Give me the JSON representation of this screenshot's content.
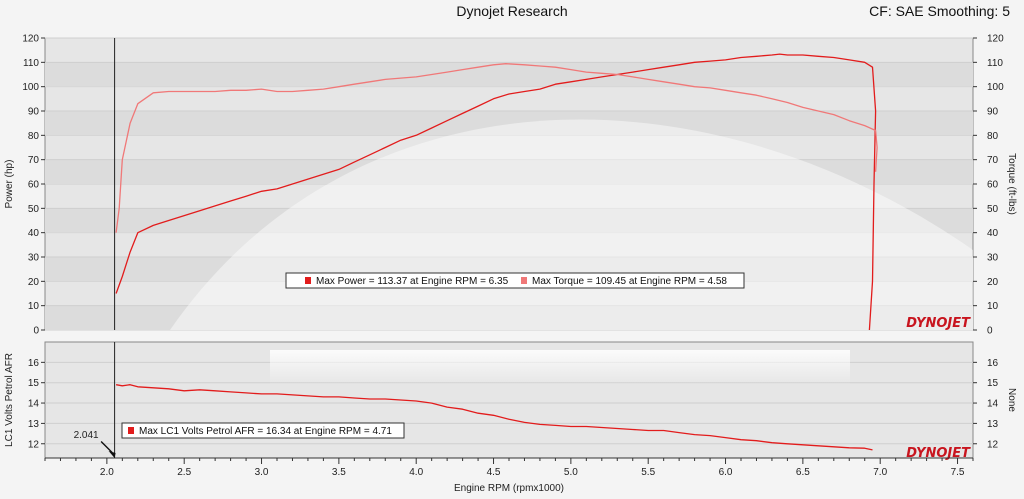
{
  "header": {
    "title": "Dynojet Research",
    "settings": "CF: SAE Smoothing: 5"
  },
  "logo": {
    "text": "DYNOJET"
  },
  "colors": {
    "power": "#e21c1c",
    "torque": "#f07878",
    "afr": "#e21c1c",
    "bg": "#f4f4f4",
    "plot": "#e6e6e6"
  },
  "cursor": {
    "rpm": 2.05,
    "label": "2.041"
  },
  "chart_data": [
    {
      "type": "line",
      "id": "power-torque",
      "xlabel": "",
      "ylabel": "Power (hp)",
      "y2label": "Torque (ft-lbs)",
      "xlim": [
        1.6,
        7.6
      ],
      "ylim": [
        0,
        120
      ],
      "y2lim": [
        0,
        120
      ],
      "yticks": [
        0,
        10,
        20,
        30,
        40,
        50,
        60,
        70,
        80,
        90,
        100,
        110,
        120
      ],
      "grid": true,
      "series": [
        {
          "name": "Power",
          "color": "#e21c1c",
          "x": [
            2.06,
            2.1,
            2.15,
            2.2,
            2.3,
            2.4,
            2.5,
            2.6,
            2.7,
            2.8,
            2.9,
            3.0,
            3.1,
            3.2,
            3.3,
            3.4,
            3.5,
            3.6,
            3.7,
            3.8,
            3.9,
            4.0,
            4.1,
            4.2,
            4.3,
            4.4,
            4.5,
            4.6,
            4.7,
            4.8,
            4.9,
            5.0,
            5.1,
            5.2,
            5.3,
            5.4,
            5.5,
            5.6,
            5.7,
            5.8,
            5.9,
            6.0,
            6.1,
            6.2,
            6.3,
            6.35,
            6.4,
            6.5,
            6.6,
            6.7,
            6.8,
            6.9,
            6.95,
            6.97,
            6.96,
            6.95,
            6.93
          ],
          "y": [
            15,
            22,
            32,
            40,
            43,
            45,
            47,
            49,
            51,
            53,
            55,
            57,
            58,
            60,
            62,
            64,
            66,
            69,
            72,
            75,
            78,
            80,
            83,
            86,
            89,
            92,
            95,
            97,
            98,
            99,
            101,
            102,
            103,
            104,
            105,
            106,
            107,
            108,
            109,
            110,
            110.5,
            111,
            112,
            112.5,
            113,
            113.37,
            113,
            113,
            112.5,
            112,
            111,
            110,
            108,
            90,
            60,
            20,
            0
          ]
        },
        {
          "name": "Torque",
          "color": "#f07878",
          "x": [
            2.06,
            2.08,
            2.1,
            2.15,
            2.2,
            2.3,
            2.4,
            2.5,
            2.6,
            2.7,
            2.8,
            2.9,
            3.0,
            3.1,
            3.2,
            3.3,
            3.4,
            3.5,
            3.6,
            3.7,
            3.8,
            3.9,
            4.0,
            4.1,
            4.2,
            4.3,
            4.4,
            4.5,
            4.58,
            4.7,
            4.8,
            4.9,
            5.0,
            5.1,
            5.2,
            5.3,
            5.4,
            5.5,
            5.6,
            5.7,
            5.8,
            5.9,
            6.0,
            6.1,
            6.2,
            6.3,
            6.4,
            6.5,
            6.6,
            6.7,
            6.8,
            6.9,
            6.97,
            6.98,
            6.97
          ],
          "y": [
            40,
            50,
            70,
            85,
            93,
            97.5,
            98,
            98,
            98,
            98,
            98.5,
            98.5,
            99,
            98,
            98,
            98.5,
            99,
            100,
            101,
            102,
            103,
            103.5,
            104,
            105,
            106,
            107,
            108,
            109,
            109.45,
            109,
            108.5,
            108,
            107,
            106,
            105.5,
            105,
            104,
            103,
            102,
            101,
            100,
            99.5,
            98.5,
            97.5,
            96.5,
            95,
            93.5,
            91.5,
            90,
            88.5,
            86,
            84,
            82,
            75,
            65
          ]
        }
      ],
      "legend": [
        {
          "label": "Max Power = 113.37 at Engine RPM = 6.35",
          "color": "#e21c1c"
        },
        {
          "label": "Max Torque = 109.45 at Engine RPM = 4.58",
          "color": "#f07878"
        }
      ]
    },
    {
      "type": "line",
      "id": "afr",
      "xlabel": "Engine RPM (rpmx1000)",
      "ylabel": "LC1 Volts Petrol AFR",
      "y2label": "None",
      "xlim": [
        1.6,
        7.6
      ],
      "ylim": [
        11.3,
        17.0
      ],
      "yticks": [
        12,
        13,
        14,
        15,
        16
      ],
      "xticks": [
        2.0,
        2.5,
        3.0,
        3.5,
        4.0,
        4.5,
        5.0,
        5.5,
        6.0,
        6.5,
        7.0,
        7.5
      ],
      "xticklabels": [
        "2.0",
        "2.5",
        "3.0",
        "3.5",
        "4.0",
        "4.5",
        "5.0",
        "5.5",
        "6.0",
        "6.5",
        "7.0",
        "7.5"
      ],
      "grid": true,
      "series": [
        {
          "name": "LC1 Volts Petrol AFR",
          "color": "#e21c1c",
          "x": [
            2.06,
            2.1,
            2.15,
            2.2,
            2.3,
            2.4,
            2.5,
            2.6,
            2.7,
            2.8,
            2.9,
            3.0,
            3.1,
            3.2,
            3.3,
            3.4,
            3.5,
            3.6,
            3.7,
            3.8,
            3.9,
            4.0,
            4.1,
            4.2,
            4.3,
            4.4,
            4.5,
            4.6,
            4.7,
            4.8,
            4.9,
            5.0,
            5.1,
            5.2,
            5.3,
            5.4,
            5.5,
            5.6,
            5.7,
            5.8,
            5.9,
            6.0,
            6.1,
            6.2,
            6.3,
            6.4,
            6.5,
            6.6,
            6.7,
            6.8,
            6.9,
            6.95
          ],
          "y": [
            14.9,
            14.85,
            14.9,
            14.8,
            14.75,
            14.7,
            14.6,
            14.65,
            14.6,
            14.55,
            14.5,
            14.45,
            14.45,
            14.4,
            14.35,
            14.3,
            14.3,
            14.25,
            14.2,
            14.2,
            14.15,
            14.1,
            14.0,
            13.8,
            13.7,
            13.5,
            13.4,
            13.2,
            13.05,
            12.95,
            12.9,
            12.85,
            12.85,
            12.8,
            12.75,
            12.7,
            12.65,
            12.65,
            12.55,
            12.45,
            12.4,
            12.3,
            12.2,
            12.15,
            12.05,
            12.0,
            11.95,
            11.9,
            11.85,
            11.8,
            11.78,
            11.7
          ]
        }
      ],
      "legend": [
        {
          "label": "Max LC1 Volts Petrol AFR = 16.34 at Engine RPM = 4.71",
          "color": "#e21c1c"
        }
      ]
    }
  ]
}
